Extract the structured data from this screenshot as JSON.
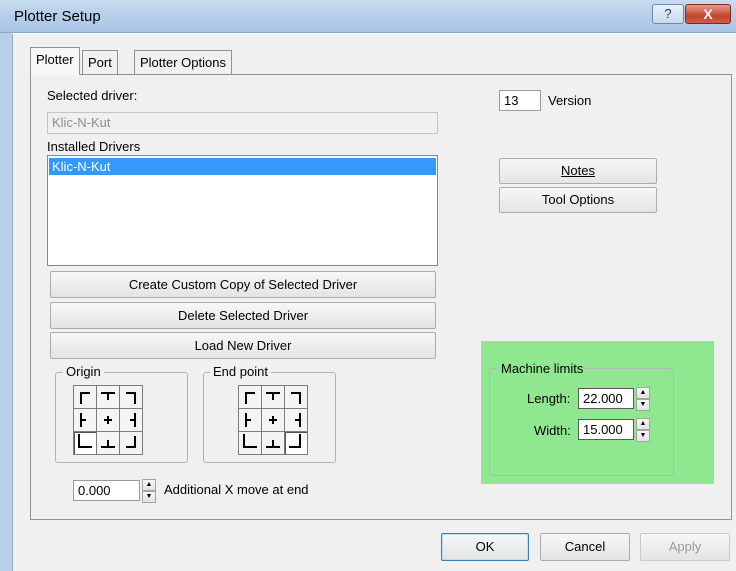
{
  "window": {
    "title": "Plotter Setup",
    "help_glyph": "?",
    "close_glyph": "X"
  },
  "tabs": [
    {
      "label": "Plotter",
      "active": true
    },
    {
      "label": "Port",
      "active": false
    },
    {
      "label": "Plotter Options",
      "active": false
    }
  ],
  "plotter": {
    "selected_driver_label": "Selected driver:",
    "selected_driver_value": "Klic-N-Kut",
    "installed_drivers_label": "Installed Drivers",
    "installed_drivers": [
      "Klic-N-Kut"
    ],
    "version_value": "13",
    "version_label": "Version",
    "notes_button": "Notes",
    "tool_options_button": "Tool Options",
    "create_copy_button": "Create Custom Copy of Selected Driver",
    "delete_button": "Delete Selected Driver",
    "load_button": "Load New Driver",
    "origin_label": "Origin",
    "endpoint_label": "End point",
    "additional_x_value": "0.000",
    "additional_x_label": "Additional X move at end"
  },
  "machine_limits": {
    "title": "Machine limits",
    "length_label": "Length:",
    "length_value": "22.000",
    "width_label": "Width:",
    "width_value": "15.000",
    "highlight_color": "#8fe890"
  },
  "footer": {
    "ok_button": "OK",
    "cancel_button": "Cancel",
    "apply_button": "Apply"
  },
  "icons": {
    "spin_up": "▲",
    "spin_down": "▼"
  }
}
